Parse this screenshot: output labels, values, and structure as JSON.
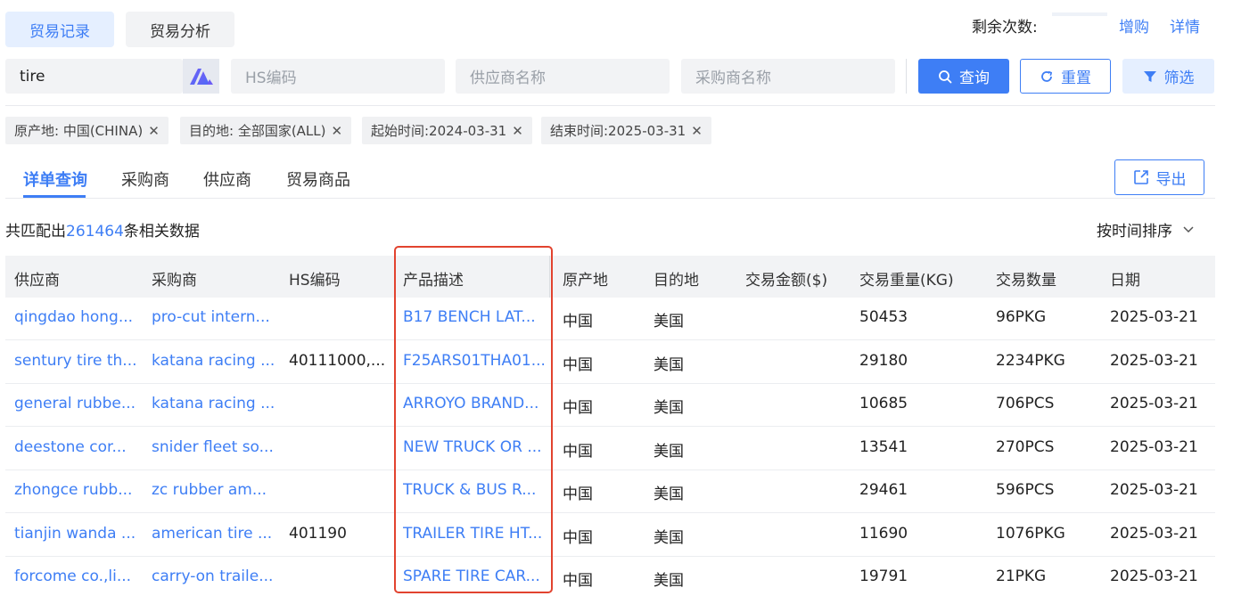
{
  "top_tabs": {
    "records": "贸易记录",
    "analysis": "贸易分析"
  },
  "header": {
    "remaining_label": "剩余次数:",
    "recharge": "增购",
    "details": "详情"
  },
  "search": {
    "keyword_value": "tire",
    "hs_placeholder": "HS编码",
    "supplier_placeholder": "供应商名称",
    "buyer_placeholder": "采购商名称",
    "query_label": "查询",
    "reset_label": "重置",
    "filter_label": "筛选"
  },
  "chips": [
    {
      "label": "原产地: 中国(CHINA)"
    },
    {
      "label": "目的地: 全部国家(ALL)"
    },
    {
      "label": "起始时间:2024-03-31"
    },
    {
      "label": "结束时间:2025-03-31"
    }
  ],
  "sub_tabs": [
    "详单查询",
    "采购商",
    "供应商",
    "贸易商品"
  ],
  "export_label": "导出",
  "summary": {
    "prefix": "共匹配出",
    "count": "261464",
    "suffix": "条相关数据"
  },
  "sort_label": "按时间排序",
  "table": {
    "headers": [
      "供应商",
      "采购商",
      "HS编码",
      "产品描述",
      "原产地",
      "目的地",
      "交易金额($)",
      "交易重量(KG)",
      "交易数量",
      "日期"
    ],
    "rows": [
      {
        "supplier": "qingdao hong...",
        "buyer": "pro-cut intern...",
        "hs": "",
        "desc": "B17 BENCH LAT...",
        "origin": "中国",
        "dest": "美国",
        "amount": "",
        "weight": "50453",
        "qty": "96PKG",
        "date": "2025-03-21"
      },
      {
        "supplier": "sentury tire th...",
        "buyer": "katana racing ...",
        "hs": "40111000,...",
        "desc": "F25ARS01THA01...",
        "origin": "中国",
        "dest": "美国",
        "amount": "",
        "weight": "29180",
        "qty": "2234PKG",
        "date": "2025-03-21"
      },
      {
        "supplier": "general rubbe...",
        "buyer": "katana racing ...",
        "hs": "",
        "desc": "ARROYO BRAND...",
        "origin": "中国",
        "dest": "美国",
        "amount": "",
        "weight": "10685",
        "qty": "706PCS",
        "date": "2025-03-21"
      },
      {
        "supplier": "deestone cor...",
        "buyer": "snider fleet so...",
        "hs": "",
        "desc": "NEW TRUCK OR ...",
        "origin": "中国",
        "dest": "美国",
        "amount": "",
        "weight": "13541",
        "qty": "270PCS",
        "date": "2025-03-21"
      },
      {
        "supplier": "zhongce rubb...",
        "buyer": "zc rubber am...",
        "hs": "",
        "desc": "TRUCK & BUS R...",
        "origin": "中国",
        "dest": "美国",
        "amount": "",
        "weight": "29461",
        "qty": "596PCS",
        "date": "2025-03-21"
      },
      {
        "supplier": "tianjin wanda ...",
        "buyer": "american tire ...",
        "hs": "401190",
        "desc": "TRAILER TIRE HT...",
        "origin": "中国",
        "dest": "美国",
        "amount": "",
        "weight": "11690",
        "qty": "1076PKG",
        "date": "2025-03-21"
      },
      {
        "supplier": "forcome co.,li...",
        "buyer": "carry-on traile...",
        "hs": "",
        "desc": "SPARE TIRE CAR...",
        "origin": "中国",
        "dest": "美国",
        "amount": "",
        "weight": "19791",
        "qty": "21PKG",
        "date": "2025-03-21"
      }
    ]
  },
  "colors": {
    "accent": "#3e7ef5",
    "highlight": "#e2432f"
  }
}
